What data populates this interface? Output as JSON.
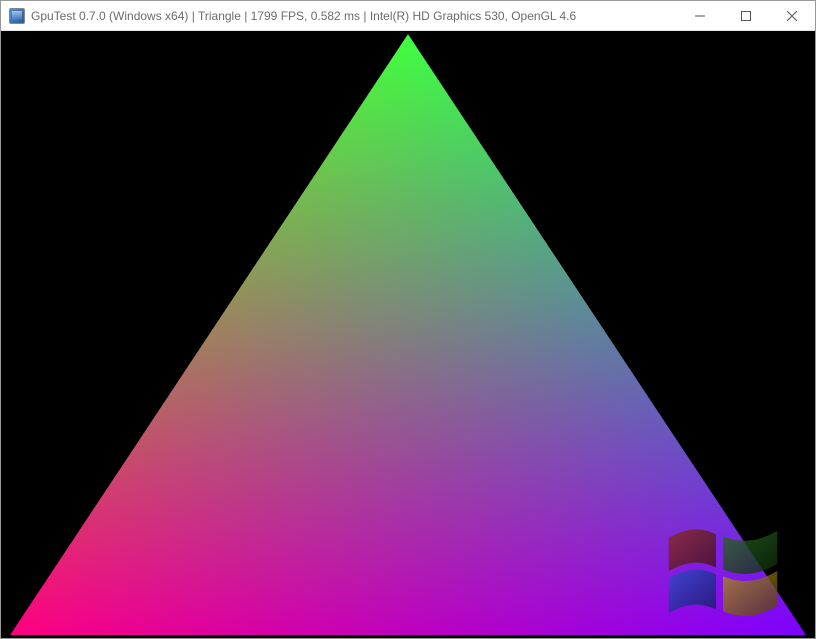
{
  "window": {
    "title": "GpuTest 0.7.0 (Windows x64) | Triangle | 1799 FPS, 0.582 ms | Intel(R) HD Graphics 530, OpenGL 4.6"
  },
  "render": {
    "background": "#000000",
    "triangle": {
      "top_color": "#00ff00",
      "left_color": "#ff0000",
      "right_color": "#0000ff"
    }
  }
}
